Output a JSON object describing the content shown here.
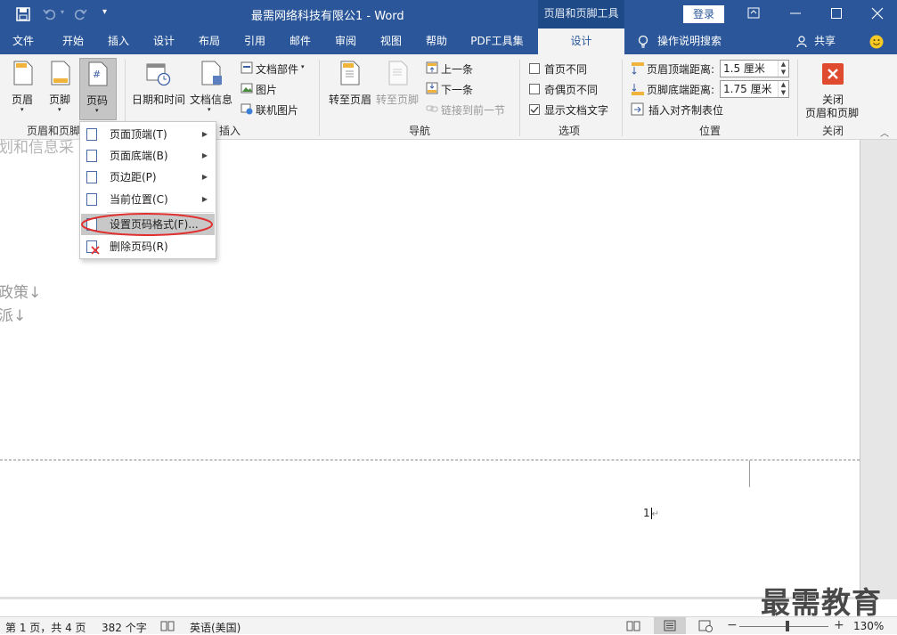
{
  "titlebar": {
    "save_icon": "save-icon",
    "doc_title": "最需网络科技有限公1  -  Word",
    "context_tools": "页眉和页脚工具",
    "login": "登录",
    "window_controls": [
      "ribbon-display-icon",
      "minimize-icon",
      "maximize-icon",
      "close-icon"
    ]
  },
  "tabs": [
    "文件",
    "开始",
    "插入",
    "设计",
    "布局",
    "引用",
    "邮件",
    "审阅",
    "视图",
    "帮助",
    "PDF工具集",
    "设计"
  ],
  "tell_me": "操作说明搜索",
  "share": "共享",
  "ribbon": {
    "hf_group": {
      "header": "页眉",
      "footer": "页脚",
      "page_number": "页码",
      "label": "页眉和页脚"
    },
    "insert_group": {
      "datetime": "日期和时间",
      "docinfo": "文档信息",
      "quickparts": "文档部件",
      "picture": "图片",
      "online_picture": "联机图片",
      "label": "插入"
    },
    "nav_group": {
      "goto_header": "转至页眉",
      "goto_footer": "转至页脚",
      "prev": "上一条",
      "next": "下一条",
      "link_prev": "链接到前一节",
      "label": "导航"
    },
    "options_group": {
      "first_page": "首页不同",
      "odd_even": "奇偶页不同",
      "show_text": "显示文档文字",
      "label": "选项"
    },
    "position_group": {
      "header_dist_label": "页眉顶端距离:",
      "header_dist": "1.5 厘米",
      "footer_dist_label": "页脚底端距离:",
      "footer_dist": "1.75 厘米",
      "align_tab": "插入对齐制表位",
      "label": "位置"
    },
    "close_group": {
      "close_line1": "关闭",
      "close_line2": "页眉和页脚",
      "label": "关闭"
    }
  },
  "menu": {
    "items": [
      {
        "label": "页面顶端(T)",
        "submenu": true
      },
      {
        "label": "页面底端(B)",
        "submenu": true
      },
      {
        "label": "页边距(P)",
        "submenu": true
      },
      {
        "label": "当前位置(C)",
        "submenu": true
      },
      {
        "label": "设置页码格式(F)...",
        "submenu": false
      },
      {
        "label": "删除页码(R)",
        "submenu": false
      }
    ]
  },
  "document": {
    "line1": "划和信息采",
    "line2": "政策↓",
    "line3": "派↓",
    "page_number": "1"
  },
  "statusbar": {
    "page": "第 1 页，共 4 页",
    "words": "382 个字",
    "language": "英语(美国)",
    "zoom": "130%",
    "watermark": "最需教育"
  },
  "colors": {
    "brand": "#2b579a",
    "highlight_circle": "#e03030",
    "close_button": "#e04a2f"
  }
}
